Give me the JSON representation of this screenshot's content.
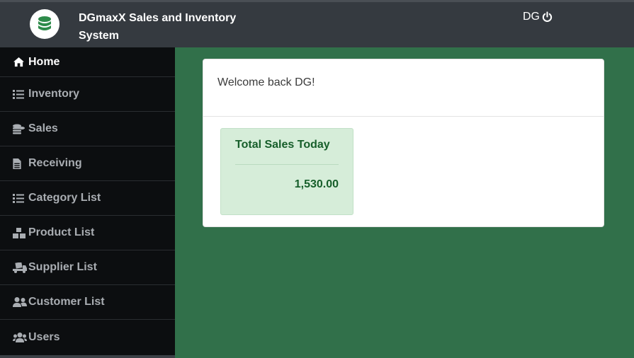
{
  "app": {
    "title": "DGmaxX Sales and Inventory System"
  },
  "user": {
    "initials": "DG"
  },
  "sidebar": {
    "items": [
      {
        "label": "Home",
        "icon": "home-icon"
      },
      {
        "label": "Inventory",
        "icon": "list-icon"
      },
      {
        "label": "Sales",
        "icon": "coins-icon"
      },
      {
        "label": "Receiving",
        "icon": "file-icon"
      },
      {
        "label": "Category List",
        "icon": "list-icon"
      },
      {
        "label": "Product List",
        "icon": "boxes-icon"
      },
      {
        "label": "Supplier List",
        "icon": "truck-icon"
      },
      {
        "label": "Customer List",
        "icon": "user-friends-icon"
      },
      {
        "label": "Users",
        "icon": "users-icon"
      }
    ]
  },
  "main": {
    "welcome": "Welcome back DG!",
    "stat": {
      "title": "Total Sales Today",
      "value": "1,530.00"
    }
  },
  "colors": {
    "topbar": "#353a40",
    "sidebar": "#0c0e10",
    "content_bg": "#31704a",
    "stat_bg": "#d6edd9",
    "stat_text": "#165e2a"
  }
}
